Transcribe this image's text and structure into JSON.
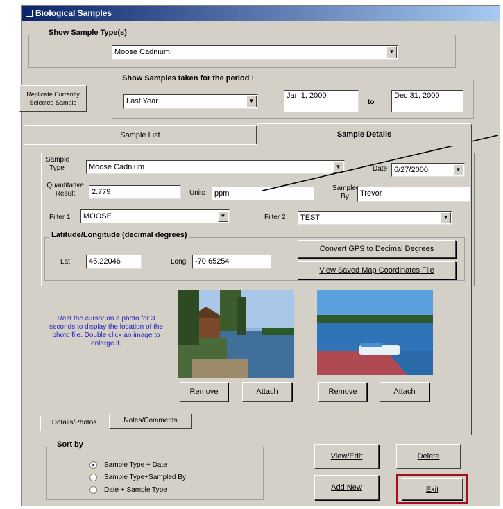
{
  "window": {
    "title": "Biological Samples",
    "close_glyph": "×"
  },
  "sample_type_group": {
    "label": "Show Sample Type(s)",
    "selected": "Moose Cadnium"
  },
  "replicate_button": {
    "label": "Replicate Currently Selected Sample"
  },
  "period_group": {
    "label": "Show Samples taken for the period :",
    "range_selected": "Last Year",
    "from_date": "Jan 1, 2000",
    "to_label": "to",
    "to_date": "Dec 31, 2000"
  },
  "tabs": {
    "list": "Sample List",
    "details": "Sample Details"
  },
  "details": {
    "sample_type_label": "Sample Type",
    "sample_type_value": "Moose Cadnium",
    "date_label": "Date",
    "date_value": "6/27/2000",
    "quant_label": "Quantitative Result",
    "quant_value": "2.779",
    "units_label": "Units",
    "units_value": "ppm",
    "sampled_by_label": "Sampled By",
    "sampled_by_value": "Trevor",
    "filter1_label": "Filter 1",
    "filter1_value": "MOOSE",
    "filter2_label": "Filter 2",
    "filter2_value": "TEST",
    "latlong_heading": "Latitude/Longitude (decimal degrees)",
    "lat_label": "Lat",
    "lat_value": "45.22046",
    "long_label": "Long",
    "long_value": "-70.65254",
    "convert_gps_button": "Convert GPS to Decimal Degrees",
    "view_map_button": "View Saved Map Coordinates File"
  },
  "photo_hint": "Rest the cursor on a photo for 3 seconds to display the location of the photo file. Double click an image to enlarge it.",
  "photo1": {
    "remove": "Remove",
    "attach": "Attach"
  },
  "photo2": {
    "remove": "Remove",
    "attach": "Attach"
  },
  "subtabs": {
    "details_photos": "Details/Photos",
    "notes_comments": "Notes/Comments"
  },
  "sort_group": {
    "label": "Sort by",
    "options": [
      "Sample Type + Date",
      "Sample Type+Sampled By",
      "Date + Sample Type"
    ],
    "selected_index": 0
  },
  "buttons": {
    "view_edit": "View/Edit",
    "delete": "Delete",
    "add_new": "Add New",
    "exit": "Exit"
  },
  "colors": {
    "title_start": "#0a246a",
    "title_end": "#a6caf0",
    "dialog_bg": "#d4d0c8",
    "exit_highlight": "#a01020",
    "hint_text": "#2020c0"
  }
}
